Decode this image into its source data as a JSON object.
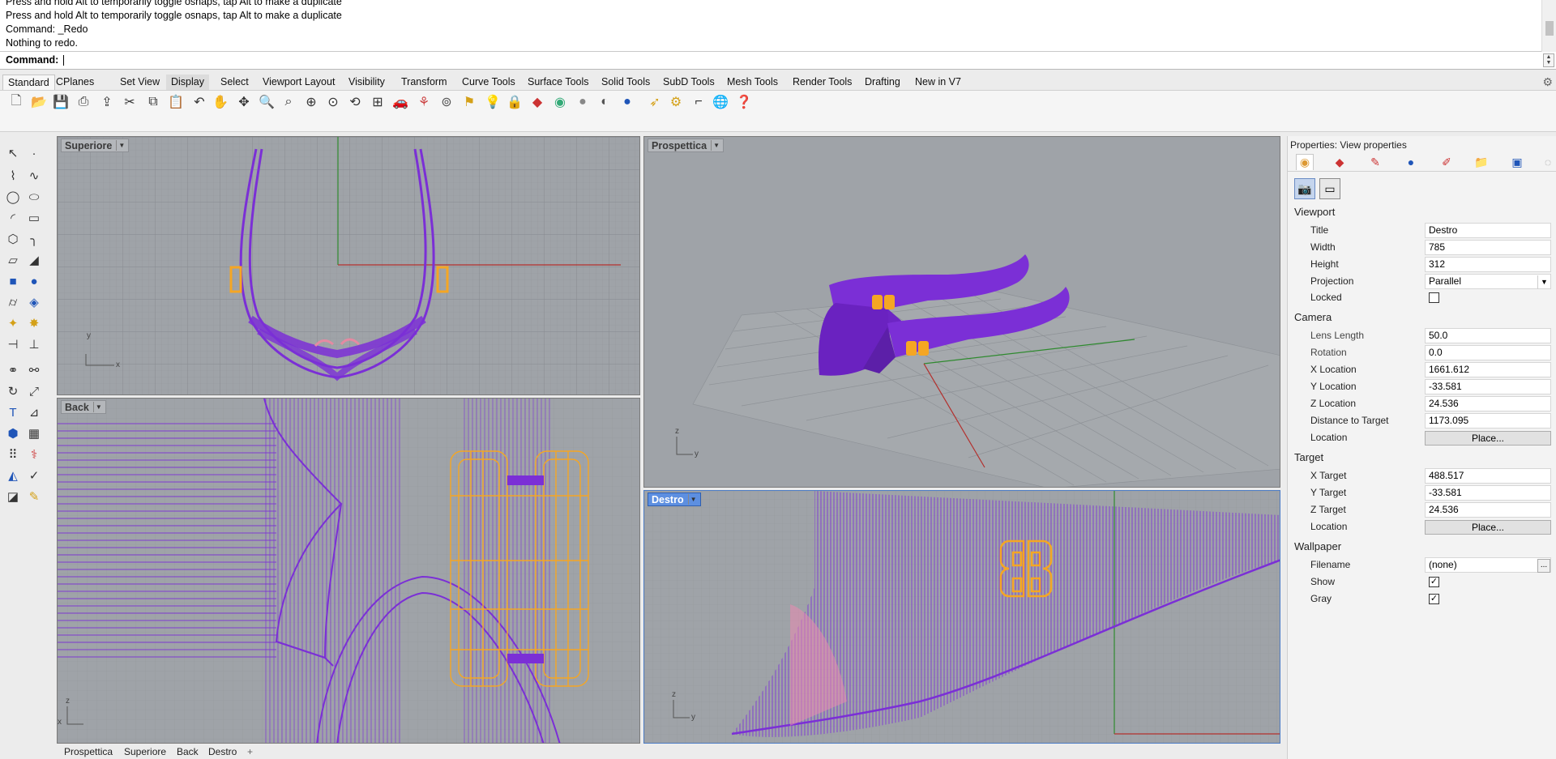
{
  "command_history": {
    "lines": [
      "Press and hold Alt to temporarily toggle osnaps, tap Alt to make a duplicate",
      "Press and hold Alt to temporarily toggle osnaps, tap Alt to make a duplicate",
      "Command: _Redo",
      "Nothing to redo."
    ]
  },
  "command_prompt": {
    "label": "Command:",
    "value": ""
  },
  "toolbar_tabs": [
    "Standard",
    "CPlanes",
    "Set View",
    "Display",
    "Select",
    "Viewport Layout",
    "Visibility",
    "Transform",
    "Curve Tools",
    "Surface Tools",
    "Solid Tools",
    "SubD Tools",
    "Mesh Tools",
    "Render Tools",
    "Drafting",
    "New in V7"
  ],
  "active_toolbar_tab": "Standard",
  "viewports": {
    "top": {
      "title": "Superiore",
      "axis_x": "x",
      "axis_y": "y"
    },
    "perspective": {
      "title": "Prospettica",
      "axis_x": "y",
      "axis_y": "z"
    },
    "back": {
      "title": "Back",
      "axis_x": "x",
      "axis_y": "z"
    },
    "right": {
      "title": "Destro",
      "axis_x": "y",
      "axis_y": "z"
    }
  },
  "viewport_tabs": [
    "Prospettica",
    "Superiore",
    "Back",
    "Destro"
  ],
  "properties": {
    "panel_title": "Properties: View properties",
    "viewport": {
      "section": "Viewport",
      "title_label": "Title",
      "title_value": "Destro",
      "width_label": "Width",
      "width_value": "785",
      "height_label": "Height",
      "height_value": "312",
      "projection_label": "Projection",
      "projection_value": "Parallel",
      "locked_label": "Locked",
      "locked": false
    },
    "camera": {
      "section": "Camera",
      "lens_label": "Lens Length",
      "lens_value": "50.0",
      "rotation_label": "Rotation",
      "rotation_value": "0.0",
      "xloc_label": "X Location",
      "xloc_value": "1661.612",
      "yloc_label": "Y Location",
      "yloc_value": "-33.581",
      "zloc_label": "Z Location",
      "zloc_value": "24.536",
      "dist_label": "Distance to Target",
      "dist_value": "1173.095",
      "location_label": "Location",
      "place_button": "Place..."
    },
    "target": {
      "section": "Target",
      "x_label": "X Target",
      "x_value": "488.517",
      "y_label": "Y Target",
      "y_value": "-33.581",
      "z_label": "Z Target",
      "z_value": "24.536",
      "location_label": "Location",
      "place_button": "Place..."
    },
    "wallpaper": {
      "section": "Wallpaper",
      "filename_label": "Filename",
      "filename_value": "(none)",
      "show_label": "Show",
      "show": true,
      "gray_label": "Gray",
      "gray": true
    }
  },
  "colors": {
    "viewport_bg": "#9fa3a8",
    "grid": "#8f9398",
    "model": "#7b2fd6",
    "selected": "#f5a623",
    "x_axis": "#b3302d",
    "y_axis": "#2f8a2f",
    "active_title": "#5d8fe0"
  }
}
